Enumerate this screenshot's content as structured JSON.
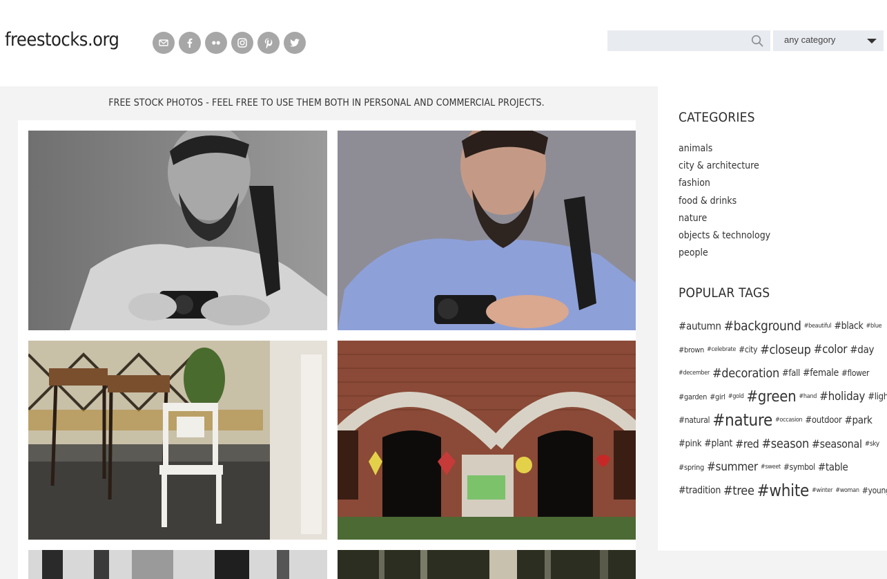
{
  "site": {
    "logo": "freestocks.org"
  },
  "social": [
    {
      "name": "email-icon"
    },
    {
      "name": "facebook-icon"
    },
    {
      "name": "flickr-icon"
    },
    {
      "name": "instagram-icon"
    },
    {
      "name": "pinterest-icon"
    },
    {
      "name": "twitter-icon"
    }
  ],
  "search": {
    "placeholder": "",
    "value": ""
  },
  "category_select": {
    "selected": "any category"
  },
  "tagline": "FREE STOCK PHOTOS - FEEL FREE TO USE THEM BOTH IN PERSONAL AND COMMERCIAL PROJECTS.",
  "sidebar": {
    "categories_title": "CATEGORIES",
    "categories": [
      "animals",
      "city & architecture",
      "fashion",
      "food & drinks",
      "nature",
      "objects & technology",
      "people"
    ],
    "tags_title": "POPULAR TAGS",
    "tag_rows": [
      [
        {
          "t": "#autumn",
          "s": 15
        },
        {
          "t": "#background",
          "s": 19
        },
        {
          "t": "#beautiful",
          "s": 9
        },
        {
          "t": "#black",
          "s": 14
        },
        {
          "t": "#blue",
          "s": 9
        }
      ],
      [
        {
          "t": "#brown",
          "s": 11
        },
        {
          "t": "#celebrate",
          "s": 9
        },
        {
          "t": "#city",
          "s": 12
        },
        {
          "t": "#closeup",
          "s": 18
        },
        {
          "t": "#color",
          "s": 17
        },
        {
          "t": "#day",
          "s": 15
        }
      ],
      [
        {
          "t": "#december",
          "s": 9
        },
        {
          "t": "#decoration",
          "s": 18
        },
        {
          "t": "#fall",
          "s": 13
        },
        {
          "t": "#female",
          "s": 14
        },
        {
          "t": "#flower",
          "s": 12
        }
      ],
      [
        {
          "t": "#garden",
          "s": 11
        },
        {
          "t": "#girl",
          "s": 11
        },
        {
          "t": "#gold",
          "s": 9
        },
        {
          "t": "#green",
          "s": 22
        },
        {
          "t": "#hand",
          "s": 9
        },
        {
          "t": "#holiday",
          "s": 17
        },
        {
          "t": "#light",
          "s": 13
        }
      ],
      [
        {
          "t": "#natural",
          "s": 12
        },
        {
          "t": "#nature",
          "s": 24
        },
        {
          "t": "#occasion",
          "s": 9
        },
        {
          "t": "#outdoor",
          "s": 13
        },
        {
          "t": "#park",
          "s": 15
        }
      ],
      [
        {
          "t": "#pink",
          "s": 13
        },
        {
          "t": "#plant",
          "s": 14
        },
        {
          "t": "#red",
          "s": 16
        },
        {
          "t": "#season",
          "s": 18
        },
        {
          "t": "#seasonal",
          "s": 16
        },
        {
          "t": "#sky",
          "s": 10
        }
      ],
      [
        {
          "t": "#spring",
          "s": 11
        },
        {
          "t": "#summer",
          "s": 17
        },
        {
          "t": "#sweet",
          "s": 9
        },
        {
          "t": "#symbol",
          "s": 12
        },
        {
          "t": "#table",
          "s": 15
        }
      ],
      [
        {
          "t": "#tradition",
          "s": 14
        },
        {
          "t": "#tree",
          "s": 18
        },
        {
          "t": "#white",
          "s": 24
        },
        {
          "t": "#winter",
          "s": 9
        },
        {
          "t": "#woman",
          "s": 9
        },
        {
          "t": "#young",
          "s": 12
        }
      ]
    ]
  },
  "photos": [
    {
      "name": "photo-man-camera-bw"
    },
    {
      "name": "photo-man-camera-color"
    },
    {
      "name": "photo-white-chair"
    },
    {
      "name": "photo-brick-arches-graffiti"
    },
    {
      "name": "photo-trees-bw"
    },
    {
      "name": "photo-forest"
    }
  ]
}
